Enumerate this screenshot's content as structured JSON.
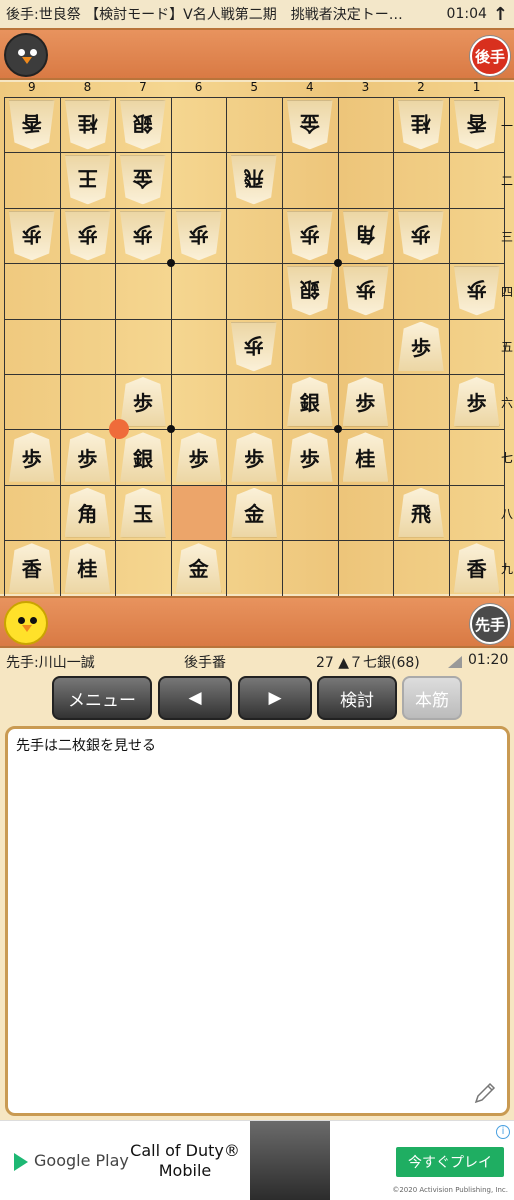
{
  "status_bar": {
    "title": "後手:世良祭 【検討モード】V名人戦第二期　挑戦者決定トー…",
    "time": "01:04",
    "arrow": "↑"
  },
  "gote_hand": {
    "badge": "後手"
  },
  "sente_hand": {
    "badge": "先手"
  },
  "board": {
    "file_labels": [
      "9",
      "8",
      "7",
      "6",
      "5",
      "4",
      "3",
      "2",
      "1"
    ],
    "rank_labels": [
      "一",
      "二",
      "三",
      "四",
      "五",
      "六",
      "七",
      "八",
      "九"
    ],
    "pieces": [
      {
        "file": 9,
        "rank": 1,
        "char": "香",
        "side": "gote"
      },
      {
        "file": 8,
        "rank": 1,
        "char": "桂",
        "side": "gote"
      },
      {
        "file": 7,
        "rank": 1,
        "char": "銀",
        "side": "gote"
      },
      {
        "file": 4,
        "rank": 1,
        "char": "金",
        "side": "gote"
      },
      {
        "file": 2,
        "rank": 1,
        "char": "桂",
        "side": "gote"
      },
      {
        "file": 1,
        "rank": 1,
        "char": "香",
        "side": "gote"
      },
      {
        "file": 8,
        "rank": 2,
        "char": "王",
        "side": "gote"
      },
      {
        "file": 7,
        "rank": 2,
        "char": "金",
        "side": "gote"
      },
      {
        "file": 5,
        "rank": 2,
        "char": "飛",
        "side": "gote"
      },
      {
        "file": 9,
        "rank": 3,
        "char": "歩",
        "side": "gote"
      },
      {
        "file": 8,
        "rank": 3,
        "char": "歩",
        "side": "gote"
      },
      {
        "file": 7,
        "rank": 3,
        "char": "歩",
        "side": "gote"
      },
      {
        "file": 6,
        "rank": 3,
        "char": "歩",
        "side": "gote"
      },
      {
        "file": 4,
        "rank": 3,
        "char": "歩",
        "side": "gote"
      },
      {
        "file": 3,
        "rank": 3,
        "char": "角",
        "side": "gote"
      },
      {
        "file": 2,
        "rank": 3,
        "char": "歩",
        "side": "gote"
      },
      {
        "file": 4,
        "rank": 4,
        "char": "銀",
        "side": "gote"
      },
      {
        "file": 3,
        "rank": 4,
        "char": "歩",
        "side": "gote"
      },
      {
        "file": 1,
        "rank": 4,
        "char": "歩",
        "side": "gote"
      },
      {
        "file": 5,
        "rank": 5,
        "char": "歩",
        "side": "gote"
      },
      {
        "file": 2,
        "rank": 5,
        "char": "歩",
        "side": "sente"
      },
      {
        "file": 7,
        "rank": 6,
        "char": "歩",
        "side": "sente"
      },
      {
        "file": 4,
        "rank": 6,
        "char": "銀",
        "side": "sente"
      },
      {
        "file": 3,
        "rank": 6,
        "char": "歩",
        "side": "sente"
      },
      {
        "file": 1,
        "rank": 6,
        "char": "歩",
        "side": "sente"
      },
      {
        "file": 9,
        "rank": 7,
        "char": "歩",
        "side": "sente"
      },
      {
        "file": 8,
        "rank": 7,
        "char": "歩",
        "side": "sente"
      },
      {
        "file": 7,
        "rank": 7,
        "char": "銀",
        "side": "sente"
      },
      {
        "file": 6,
        "rank": 7,
        "char": "歩",
        "side": "sente"
      },
      {
        "file": 5,
        "rank": 7,
        "char": "歩",
        "side": "sente"
      },
      {
        "file": 4,
        "rank": 7,
        "char": "歩",
        "side": "sente"
      },
      {
        "file": 3,
        "rank": 7,
        "char": "桂",
        "side": "sente"
      },
      {
        "file": 8,
        "rank": 8,
        "char": "角",
        "side": "sente"
      },
      {
        "file": 7,
        "rank": 8,
        "char": "玉",
        "side": "sente"
      },
      {
        "file": 5,
        "rank": 8,
        "char": "金",
        "side": "sente"
      },
      {
        "file": 2,
        "rank": 8,
        "char": "飛",
        "side": "sente"
      },
      {
        "file": 9,
        "rank": 9,
        "char": "香",
        "side": "sente"
      },
      {
        "file": 8,
        "rank": 9,
        "char": "桂",
        "side": "sente"
      },
      {
        "file": 6,
        "rank": 9,
        "char": "金",
        "side": "sente"
      },
      {
        "file": 1,
        "rank": 9,
        "char": "香",
        "side": "sente"
      }
    ],
    "highlight": {
      "file": 6,
      "rank": 8
    },
    "last_move": {
      "file": 7,
      "rank": 7
    }
  },
  "info": {
    "sente_player": "先手:川山一誠",
    "turn": "後手番",
    "move": "27 ▲７七銀(68)",
    "clock": "01:20"
  },
  "controls": {
    "menu": "メニュー",
    "prev": "◀",
    "next": "▶",
    "review": "検討",
    "mainline": "本筋"
  },
  "comment": "先手は二枚銀を見せる",
  "ad": {
    "store": "Google Play",
    "game_line1": "Call of Duty®",
    "game_line2": "Mobile",
    "cta": "今すぐプレイ",
    "copyright": "©2020 Activision Publishing, Inc.",
    "info": "i"
  }
}
